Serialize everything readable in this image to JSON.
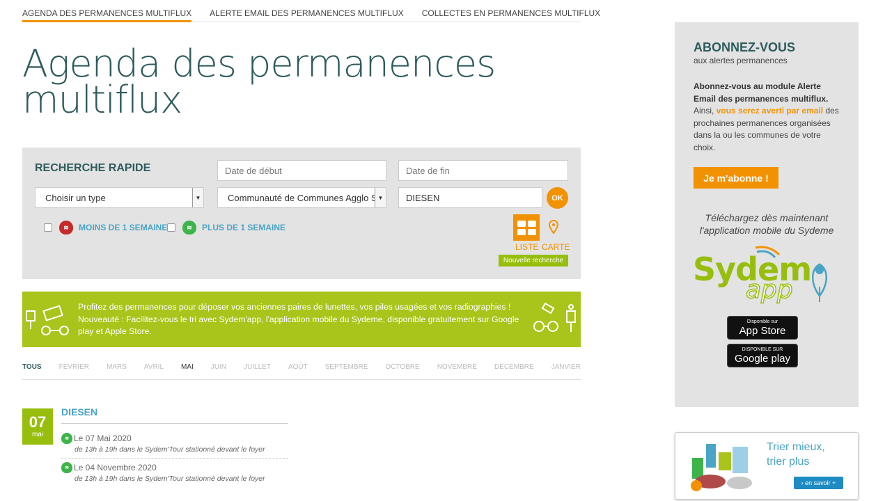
{
  "tabs": [
    {
      "label": "AGENDA DES PERMANENCES MULTIFLUX",
      "active": true
    },
    {
      "label": "ALERTE EMAIL DES PERMANENCES MULTIFLUX"
    },
    {
      "label": "COLLECTES EN PERMANENCES MULTIFLUX"
    }
  ],
  "page_title_line1": "Agenda des permanences",
  "page_title_line2": "multiflux",
  "search": {
    "title": "RECHERCHE RAPIDE",
    "date_start_placeholder": "Date de début",
    "date_end_placeholder": "Date de fin",
    "type_select": "Choisir un type",
    "community_select": "Communauté de Communes Agglo Sarreguemines",
    "city_value": "DIESEN",
    "ok_label": "OK",
    "filter_less": "MOINS DE 1 SEMAINE",
    "filter_more": "PLUS DE 1 SEMAINE",
    "view_list": "LISTE",
    "view_map": "CARTE",
    "new_search": "Nouvelle recherche"
  },
  "banner": {
    "line1": "Profitez des permanences pour déposer vos anciennes paires de lunettes, vos piles usagées et vos radiographies !",
    "line2": "Nouveauté : Facilitez-vous le tri avec Sydem'app, l'application mobile du Sydeme, disponible gratuitement sur Google play et Apple Store."
  },
  "months": [
    "TOUS",
    "FÉVRIER",
    "MARS",
    "AVRIL",
    "MAI",
    "JUIN",
    "JUILLET",
    "AOÛT",
    "SEPTEMBRE",
    "OCTOBRE",
    "NOVEMBRE",
    "DÉCEMBRE",
    "JANVIER"
  ],
  "event": {
    "day": "07",
    "month": "mai",
    "city": "DIESEN",
    "items": [
      {
        "date": "Le 07 Mai 2020",
        "desc": "de 13h à 19h dans le Sydem'Tour stationné devant le foyer"
      },
      {
        "date": "Le 04 Novembre 2020",
        "desc": "de 13h à 19h dans le Sydem'Tour stationné devant le foyer"
      }
    ]
  },
  "sidebar": {
    "title": "ABONNEZ-VOUS",
    "subtitle": "aux alertes permanences",
    "text_bold": "Abonnez-vous au module Alerte Email des permanences multiflux.",
    "text_pre": "Ainsi, ",
    "text_highlight": "vous serez averti par email",
    "text_post": " des prochaines permanences organisées dans la ou les communes de votre choix.",
    "button": "Je m'abonne !",
    "download_line1": "Téléchargez dès maintenant",
    "download_line2": "l'application mobile du Sydeme",
    "logo_main": "Sydem",
    "logo_sub": "app",
    "appstore_small": "Disponible sur",
    "appstore_big": "App Store",
    "googleplay_small": "DISPONIBLE SUR",
    "googleplay_big": "Google play"
  },
  "ad": {
    "title_line1": "Trier mieux,",
    "title_line2": "trier plus",
    "button": "› en savoir +"
  },
  "colors": {
    "accent": "#f39200",
    "green": "#97be0d",
    "banner_green": "#a9c41a",
    "title_teal": "#2f5b5d",
    "link_blue": "#4aa4c6"
  }
}
